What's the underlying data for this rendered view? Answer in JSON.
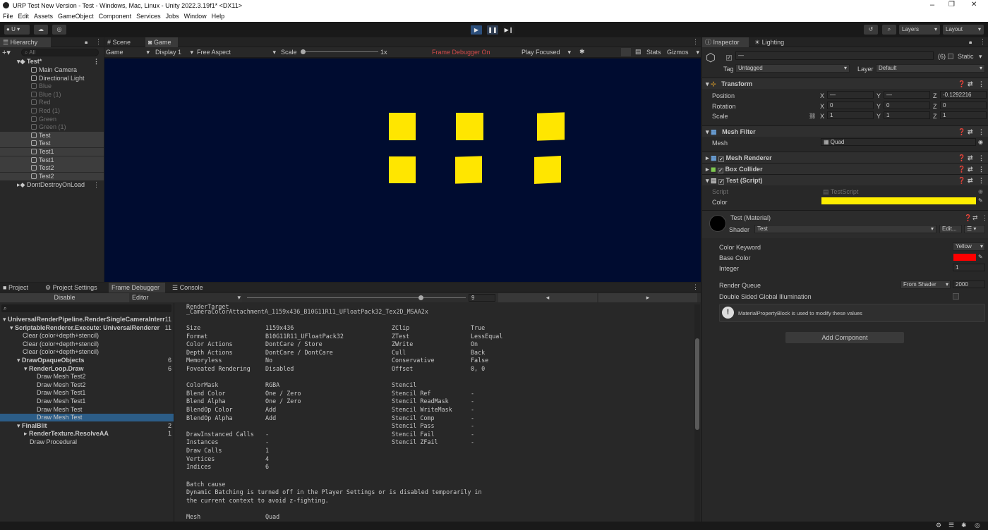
{
  "window": {
    "title": "URP Test New Version - Test - Windows, Mac, Linux - Unity 2022.3.19f1* <DX11>",
    "minimize": "–",
    "maximize": "❐",
    "close": "✕"
  },
  "menu": [
    "File",
    "Edit",
    "Assets",
    "GameObject",
    "Component",
    "Services",
    "Jobs",
    "Window",
    "Help"
  ],
  "toolbar": {
    "account": "U ▾",
    "layers": "Layers",
    "layout": "Layout"
  },
  "hierarchy": {
    "tab": "Hierarchy",
    "search_placeholder": "All",
    "scene": "Test*",
    "items": [
      {
        "label": "Main Camera",
        "state": "normal"
      },
      {
        "label": "Directional Light",
        "state": "normal"
      },
      {
        "label": "Blue",
        "state": "dim"
      },
      {
        "label": "Blue (1)",
        "state": "dim"
      },
      {
        "label": "Red",
        "state": "dim"
      },
      {
        "label": "Red (1)",
        "state": "dim"
      },
      {
        "label": "Green",
        "state": "dim"
      },
      {
        "label": "Green (1)",
        "state": "dim"
      },
      {
        "label": "Test",
        "state": "selected"
      },
      {
        "label": "Test",
        "state": "selected"
      },
      {
        "label": "Test1",
        "state": "selected"
      },
      {
        "label": "Test1",
        "state": "selected"
      },
      {
        "label": "Test2",
        "state": "selected"
      },
      {
        "label": "Test2",
        "state": "selected"
      }
    ],
    "dontdestroy": "DontDestroyOnLoad"
  },
  "sceneTabs": {
    "scene": "Scene",
    "game": "Game"
  },
  "gameToolbar": {
    "display_mode": "Game",
    "display": "Display 1",
    "aspect": "Free Aspect",
    "scale_label": "Scale",
    "scale_value": "1x",
    "frame_debugger": "Frame Debugger On",
    "play_focused": "Play Focused",
    "stats": "Stats",
    "gizmos": "Gizmos"
  },
  "gameView": {
    "background": "#000c30",
    "square_color": "#ffe600",
    "square_count": 6
  },
  "bottomTabs": {
    "project": "Project",
    "project_settings": "Project Settings",
    "frame_debugger": "Frame Debugger",
    "console": "Console"
  },
  "frameDebugger": {
    "disable": "Disable",
    "editor": "Editor",
    "event_index": "9",
    "tree": [
      {
        "label": "UniversalRenderPipeline.RenderSingleCameraInterr",
        "count": "11",
        "bold": true,
        "indent": 0,
        "sel": false
      },
      {
        "label": "ScriptableRenderer.Execute: UniversalRenderer",
        "count": "11",
        "bold": true,
        "indent": 1,
        "sel": false
      },
      {
        "label": "Clear (color+depth+stencil)",
        "count": "",
        "bold": false,
        "indent": 2,
        "sel": false
      },
      {
        "label": "Clear (color+depth+stencil)",
        "count": "",
        "bold": false,
        "indent": 2,
        "sel": false
      },
      {
        "label": "Clear (color+depth+stencil)",
        "count": "",
        "bold": false,
        "indent": 2,
        "sel": false
      },
      {
        "label": "DrawOpaqueObjects",
        "count": "6",
        "bold": true,
        "indent": 2,
        "sel": false
      },
      {
        "label": "RenderLoop.Draw",
        "count": "6",
        "bold": true,
        "indent": 3,
        "sel": false
      },
      {
        "label": "Draw Mesh Test2",
        "count": "",
        "bold": false,
        "indent": 4,
        "sel": false
      },
      {
        "label": "Draw Mesh Test2",
        "count": "",
        "bold": false,
        "indent": 4,
        "sel": false
      },
      {
        "label": "Draw Mesh Test1",
        "count": "",
        "bold": false,
        "indent": 4,
        "sel": false
      },
      {
        "label": "Draw Mesh Test1",
        "count": "",
        "bold": false,
        "indent": 4,
        "sel": false
      },
      {
        "label": "Draw Mesh Test",
        "count": "",
        "bold": false,
        "indent": 4,
        "sel": false
      },
      {
        "label": "Draw Mesh Test",
        "count": "",
        "bold": false,
        "indent": 4,
        "sel": true
      },
      {
        "label": "FinalBlit",
        "count": "2",
        "bold": true,
        "indent": 2,
        "sel": false
      },
      {
        "label": "RenderTexture.ResolveAA",
        "count": "1",
        "bold": true,
        "indent": 3,
        "sel": false
      },
      {
        "label": "Draw Procedural",
        "count": "",
        "bold": false,
        "indent": 3,
        "sel": false
      }
    ],
    "render_target_label": "RenderTarget",
    "render_target": "_CameraColorAttachmentA_1159x436_B10G11R11_UFloatPack32_Tex2D_MSAA2x",
    "left_props": [
      [
        "Size",
        "1159x436"
      ],
      [
        "Format",
        "B10G11R11_UFloatPack32"
      ],
      [
        "Color Actions",
        "DontCare / Store"
      ],
      [
        "Depth Actions",
        "DontCare / DontCare"
      ],
      [
        "Memoryless",
        "No"
      ],
      [
        "Foveated Rendering",
        "Disabled"
      ],
      [
        "",
        ""
      ],
      [
        "ColorMask",
        "RGBA"
      ],
      [
        "Blend Color",
        "One / Zero"
      ],
      [
        "Blend Alpha",
        "One / Zero"
      ],
      [
        "BlendOp Color",
        "Add"
      ],
      [
        "BlendOp Alpha",
        "Add"
      ],
      [
        "",
        ""
      ],
      [
        "DrawInstanced Calls",
        "-"
      ],
      [
        "Instances",
        "-"
      ],
      [
        "Draw Calls",
        "1"
      ],
      [
        "Vertices",
        "4"
      ],
      [
        "Indices",
        "6"
      ]
    ],
    "right_props": [
      [
        "ZClip",
        "True"
      ],
      [
        "ZTest",
        "LessEqual"
      ],
      [
        "ZWrite",
        "On"
      ],
      [
        "Cull",
        "Back"
      ],
      [
        "Conservative",
        "False"
      ],
      [
        "Offset",
        "0, 0"
      ],
      [
        "",
        ""
      ],
      [
        "Stencil",
        ""
      ],
      [
        "Stencil Ref",
        "-"
      ],
      [
        "Stencil ReadMask",
        "-"
      ],
      [
        "Stencil WriteMask",
        "-"
      ],
      [
        "Stencil Comp",
        "-"
      ],
      [
        "Stencil Pass",
        "-"
      ],
      [
        "Stencil Fail",
        "-"
      ],
      [
        "Stencil ZFail",
        "-"
      ]
    ],
    "batch_cause_label": "Batch cause",
    "batch_cause_1": "Dynamic Batching is turned off in the Player Settings or is disabled temporarily in",
    "batch_cause_2": "the current context to avoid z-fighting.",
    "mesh_label": "Mesh",
    "mesh_value": "Quad"
  },
  "inspector": {
    "tab": "Inspector",
    "lighting_tab": "Lighting",
    "name_value": "—",
    "multi_count": "(6)",
    "static": "Static",
    "tag_label": "Tag",
    "tag": "Untagged",
    "layer_label": "Layer",
    "layer": "Default",
    "transform": {
      "title": "Transform",
      "position_label": "Position",
      "rotation_label": "Rotation",
      "scale_label": "Scale",
      "position": [
        "—",
        "—",
        "-0.1292216"
      ],
      "rotation": [
        "0",
        "0",
        "0"
      ],
      "scale": [
        "1",
        "1",
        "1"
      ]
    },
    "mesh_filter": {
      "title": "Mesh Filter",
      "mesh_label": "Mesh",
      "mesh": "Quad"
    },
    "mesh_renderer": "Mesh Renderer",
    "box_collider": "Box Collider",
    "test_script": {
      "title": "Test (Script)",
      "script_label": "Script",
      "script": "TestScript",
      "color_label": "Color",
      "color": "#ffee00"
    },
    "material": {
      "title": "Test (Material)",
      "shader_label": "Shader",
      "shader": "Test",
      "edit": "Edit...",
      "menu": "☰ ▾",
      "color_keyword_label": "Color Keyword",
      "color_keyword": "Yellow",
      "base_color_label": "Base Color",
      "base_color": "#ff0000",
      "integer_label": "Integer",
      "integer": "1",
      "render_queue_label": "Render Queue",
      "render_queue_mode": "From Shader",
      "render_queue": "2000",
      "dsgi_label": "Double Sided Global Illumination",
      "info": "MaterialPropertyBlock is used to modify these values"
    },
    "add_component": "Add Component"
  }
}
